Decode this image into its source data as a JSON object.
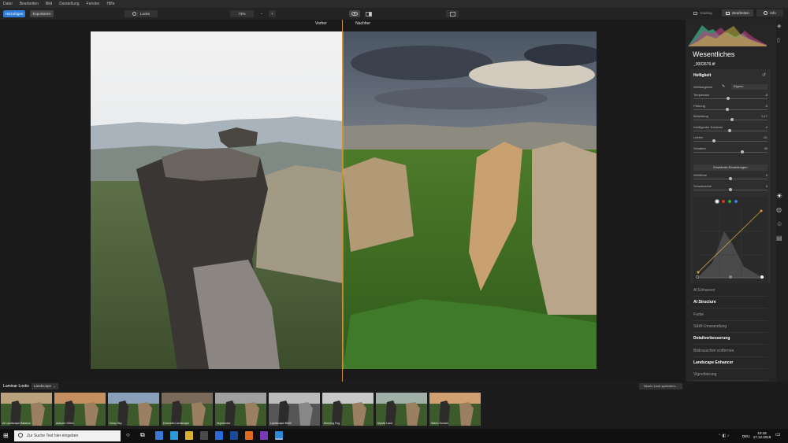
{
  "menu": [
    "Datei",
    "Bearbeiten",
    "Bild",
    "Darstellung",
    "Fenster",
    "Hilfe"
  ],
  "toolbar": {
    "import": "Hinzufügen",
    "export": "Exportieren",
    "looks": "Looks",
    "zoom": "73%",
    "zoom_minus": "–",
    "zoom_plus": "+"
  },
  "top_tabs": {
    "katalog": "Katalog",
    "edit": "Bearbeiten",
    "info": "Info"
  },
  "compare": {
    "before": "Vorher",
    "after": "Nachher"
  },
  "panel": {
    "title": "Wesentliches",
    "filename": "_0002676.tif",
    "section": "Helligkeit",
    "profile_label": "Weißabgleich",
    "profile_value": "Eigene",
    "sliders": [
      {
        "label": "Temperatur",
        "value": "-8",
        "level": 0.47
      },
      {
        "label": "Färbung",
        "value": "-9",
        "level": 0.46
      },
      {
        "label": "Belichtung",
        "value": "0,17",
        "level": 0.52
      },
      {
        "label": "Intelligenter Kontrast",
        "value": "-4",
        "level": 0.49
      },
      {
        "label": "Lichter",
        "value": "-51",
        "level": 0.27
      },
      {
        "label": "Schatten",
        "value": "35",
        "level": 0.67
      }
    ],
    "advanced_btn": "Erweiterte Einstellungen",
    "sliders2": [
      {
        "label": "Weißtöne",
        "value": "0",
        "level": 0.5
      },
      {
        "label": "Schwarztöne",
        "value": "0",
        "level": 0.5
      }
    ],
    "curve_channels": [
      "#ffffff",
      "#e03030",
      "#30b030",
      "#3080e0"
    ],
    "sections": [
      {
        "label": "AI Enhancer",
        "bold": false
      },
      {
        "label": "AI Structure",
        "bold": true
      },
      {
        "label": "Farbe",
        "bold": false
      },
      {
        "label": "S&W-Umwandlung",
        "bold": false
      },
      {
        "label": "Detailverbesserung",
        "bold": true
      },
      {
        "label": "Bildrauschen entfernen",
        "bold": false
      },
      {
        "label": "Landscape Enhancer",
        "bold": true
      },
      {
        "label": "Vignettierung",
        "bold": false
      }
    ]
  },
  "looks": {
    "title": "Luminar Looks",
    "category": "Landscape",
    "save": "Neuen Look speichern...",
    "items": [
      "AI Landscape Balance",
      "Autumn Glitch",
      "Deep Sky",
      "Dramatic Landscape",
      "Impressive",
      "Landscape B&W",
      "Morning Fog",
      "Mystic Land",
      "Warm Sunset"
    ]
  },
  "taskbar": {
    "search": "Zur Suche Text hier eingeben",
    "time": "10:18",
    "date": "17.12.2019",
    "lang": "DEU"
  }
}
